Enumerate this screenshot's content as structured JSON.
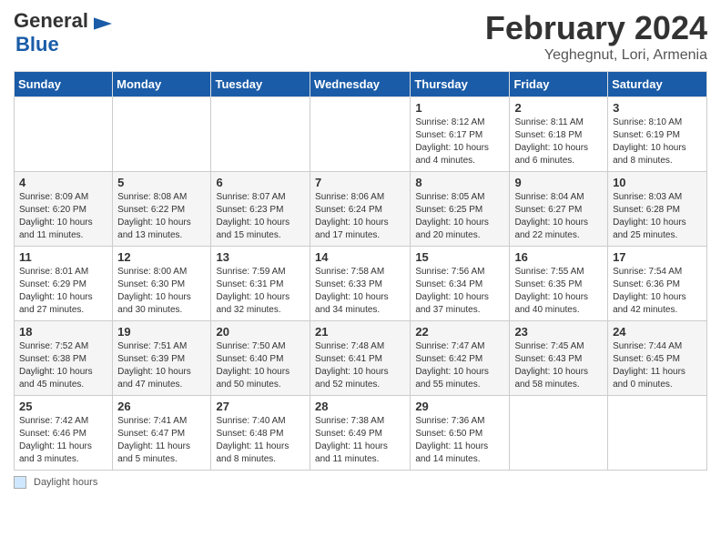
{
  "header": {
    "logo_general": "General",
    "logo_blue": "Blue",
    "month_title": "February 2024",
    "location": "Yeghegnut, Lori, Armenia"
  },
  "days_of_week": [
    "Sunday",
    "Monday",
    "Tuesday",
    "Wednesday",
    "Thursday",
    "Friday",
    "Saturday"
  ],
  "weeks": [
    [
      {
        "num": "",
        "info": ""
      },
      {
        "num": "",
        "info": ""
      },
      {
        "num": "",
        "info": ""
      },
      {
        "num": "",
        "info": ""
      },
      {
        "num": "1",
        "info": "Sunrise: 8:12 AM\nSunset: 6:17 PM\nDaylight: 10 hours and 4 minutes."
      },
      {
        "num": "2",
        "info": "Sunrise: 8:11 AM\nSunset: 6:18 PM\nDaylight: 10 hours and 6 minutes."
      },
      {
        "num": "3",
        "info": "Sunrise: 8:10 AM\nSunset: 6:19 PM\nDaylight: 10 hours and 8 minutes."
      }
    ],
    [
      {
        "num": "4",
        "info": "Sunrise: 8:09 AM\nSunset: 6:20 PM\nDaylight: 10 hours and 11 minutes."
      },
      {
        "num": "5",
        "info": "Sunrise: 8:08 AM\nSunset: 6:22 PM\nDaylight: 10 hours and 13 minutes."
      },
      {
        "num": "6",
        "info": "Sunrise: 8:07 AM\nSunset: 6:23 PM\nDaylight: 10 hours and 15 minutes."
      },
      {
        "num": "7",
        "info": "Sunrise: 8:06 AM\nSunset: 6:24 PM\nDaylight: 10 hours and 17 minutes."
      },
      {
        "num": "8",
        "info": "Sunrise: 8:05 AM\nSunset: 6:25 PM\nDaylight: 10 hours and 20 minutes."
      },
      {
        "num": "9",
        "info": "Sunrise: 8:04 AM\nSunset: 6:27 PM\nDaylight: 10 hours and 22 minutes."
      },
      {
        "num": "10",
        "info": "Sunrise: 8:03 AM\nSunset: 6:28 PM\nDaylight: 10 hours and 25 minutes."
      }
    ],
    [
      {
        "num": "11",
        "info": "Sunrise: 8:01 AM\nSunset: 6:29 PM\nDaylight: 10 hours and 27 minutes."
      },
      {
        "num": "12",
        "info": "Sunrise: 8:00 AM\nSunset: 6:30 PM\nDaylight: 10 hours and 30 minutes."
      },
      {
        "num": "13",
        "info": "Sunrise: 7:59 AM\nSunset: 6:31 PM\nDaylight: 10 hours and 32 minutes."
      },
      {
        "num": "14",
        "info": "Sunrise: 7:58 AM\nSunset: 6:33 PM\nDaylight: 10 hours and 34 minutes."
      },
      {
        "num": "15",
        "info": "Sunrise: 7:56 AM\nSunset: 6:34 PM\nDaylight: 10 hours and 37 minutes."
      },
      {
        "num": "16",
        "info": "Sunrise: 7:55 AM\nSunset: 6:35 PM\nDaylight: 10 hours and 40 minutes."
      },
      {
        "num": "17",
        "info": "Sunrise: 7:54 AM\nSunset: 6:36 PM\nDaylight: 10 hours and 42 minutes."
      }
    ],
    [
      {
        "num": "18",
        "info": "Sunrise: 7:52 AM\nSunset: 6:38 PM\nDaylight: 10 hours and 45 minutes."
      },
      {
        "num": "19",
        "info": "Sunrise: 7:51 AM\nSunset: 6:39 PM\nDaylight: 10 hours and 47 minutes."
      },
      {
        "num": "20",
        "info": "Sunrise: 7:50 AM\nSunset: 6:40 PM\nDaylight: 10 hours and 50 minutes."
      },
      {
        "num": "21",
        "info": "Sunrise: 7:48 AM\nSunset: 6:41 PM\nDaylight: 10 hours and 52 minutes."
      },
      {
        "num": "22",
        "info": "Sunrise: 7:47 AM\nSunset: 6:42 PM\nDaylight: 10 hours and 55 minutes."
      },
      {
        "num": "23",
        "info": "Sunrise: 7:45 AM\nSunset: 6:43 PM\nDaylight: 10 hours and 58 minutes."
      },
      {
        "num": "24",
        "info": "Sunrise: 7:44 AM\nSunset: 6:45 PM\nDaylight: 11 hours and 0 minutes."
      }
    ],
    [
      {
        "num": "25",
        "info": "Sunrise: 7:42 AM\nSunset: 6:46 PM\nDaylight: 11 hours and 3 minutes."
      },
      {
        "num": "26",
        "info": "Sunrise: 7:41 AM\nSunset: 6:47 PM\nDaylight: 11 hours and 5 minutes."
      },
      {
        "num": "27",
        "info": "Sunrise: 7:40 AM\nSunset: 6:48 PM\nDaylight: 11 hours and 8 minutes."
      },
      {
        "num": "28",
        "info": "Sunrise: 7:38 AM\nSunset: 6:49 PM\nDaylight: 11 hours and 11 minutes."
      },
      {
        "num": "29",
        "info": "Sunrise: 7:36 AM\nSunset: 6:50 PM\nDaylight: 11 hours and 14 minutes."
      },
      {
        "num": "",
        "info": ""
      },
      {
        "num": "",
        "info": ""
      }
    ]
  ],
  "footer": {
    "legend_label": "Daylight hours"
  }
}
